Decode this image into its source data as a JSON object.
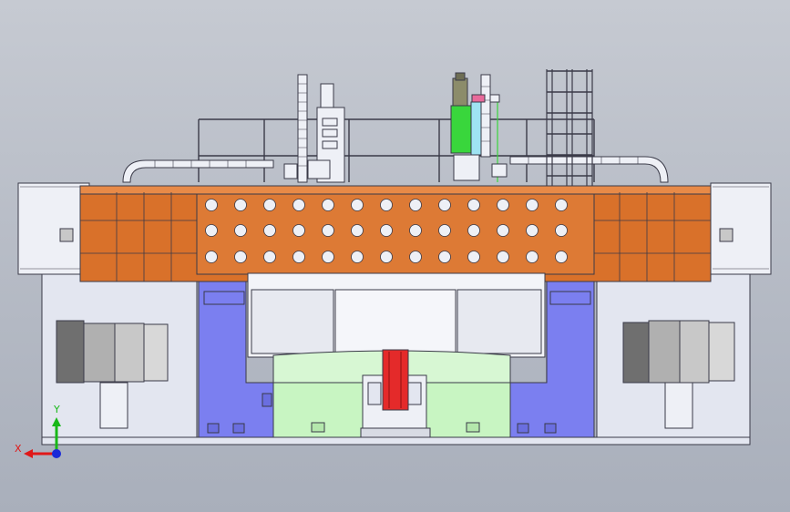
{
  "triad": {
    "x_label": "X",
    "y_label": "Y",
    "x_color": "#e01818",
    "y_color": "#18b818",
    "z_color": "#1a2ad8"
  },
  "colors": {
    "crossbeam": "#d9712a",
    "column": "#7b7ff0",
    "base": "#c8f5c2",
    "ram": "#e42a2a",
    "motor": "#39d63c",
    "frame": "#eef0f6",
    "gearbox": "#8c8c8c",
    "outline": "#3a3a48"
  }
}
